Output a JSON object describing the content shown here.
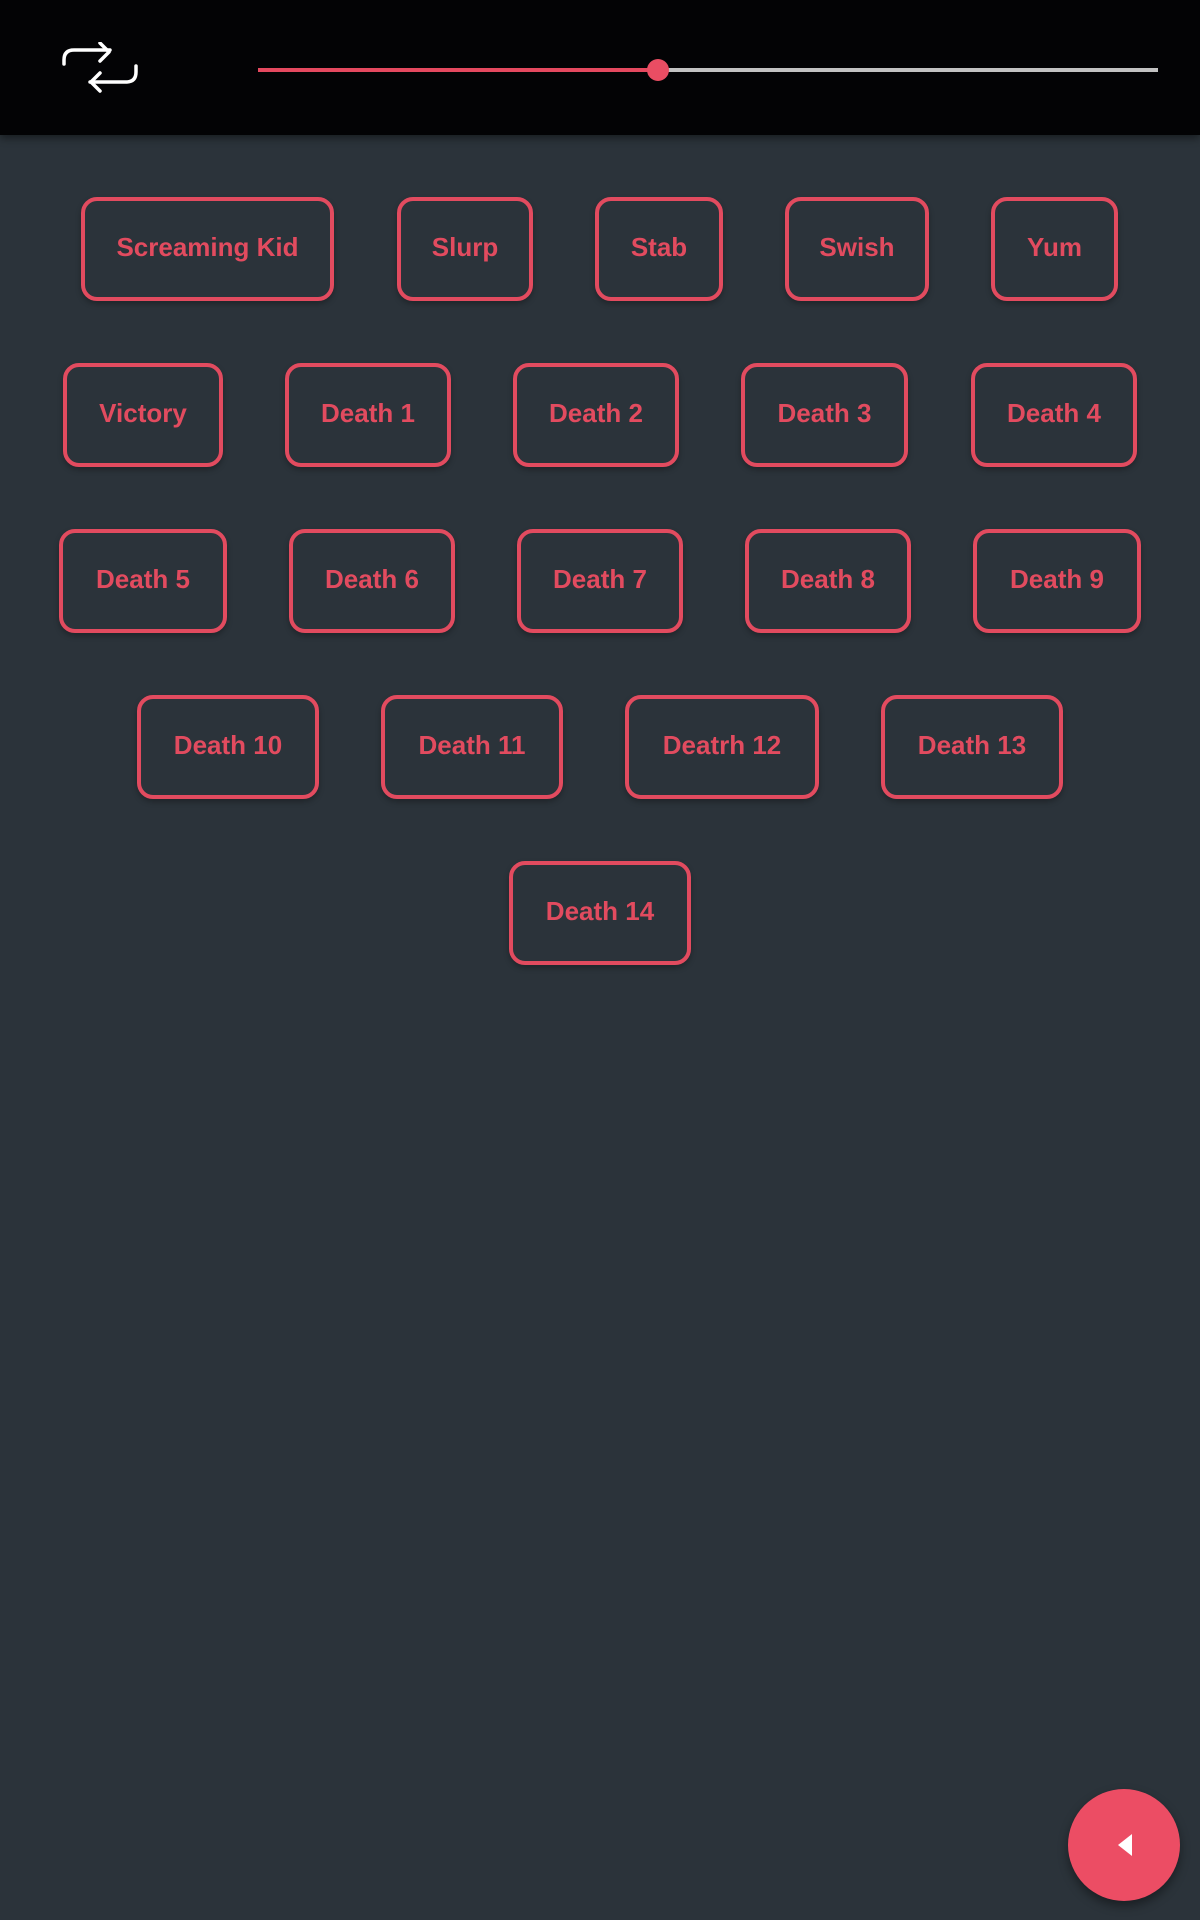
{
  "toolbar": {
    "repeat_icon": "repeat-icon",
    "volume_slider": {
      "value": 0.444,
      "min": 0,
      "max": 1
    }
  },
  "colors": {
    "accent": "#e24b5f",
    "background": "#2b333a",
    "toolbar": "#030305",
    "track_inactive": "#c2c2c2",
    "fab": "#ec4d64"
  },
  "sounds": {
    "rows": [
      [
        "Screaming Kid",
        "Slurp",
        "Stab",
        "Swish",
        "Yum"
      ],
      [
        "Victory",
        "Death 1",
        "Death 2",
        "Death 3",
        "Death 4"
      ],
      [
        "Death 5",
        "Death 6",
        "Death 7",
        "Death 8",
        "Death 9"
      ],
      [
        "Death 10",
        "Death 11",
        "Deatrh 12",
        "Death 13"
      ],
      [
        "Death 14"
      ]
    ]
  },
  "fab": {
    "icon": "caret-left-icon"
  }
}
